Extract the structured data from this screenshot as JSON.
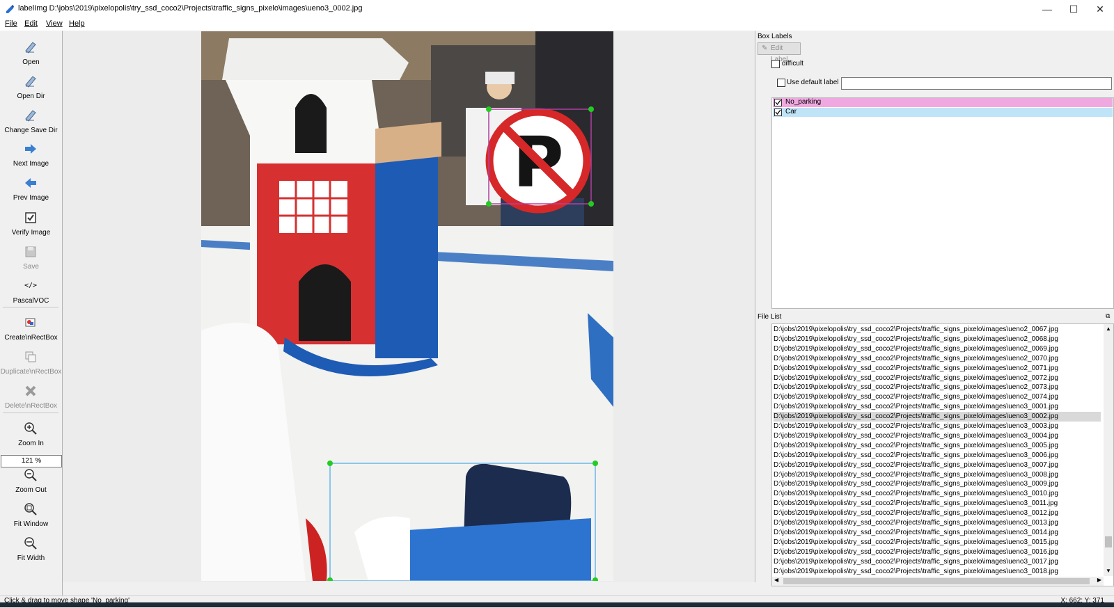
{
  "window": {
    "title": "labelImg D:\\jobs\\2019\\pixelopolis\\try_ssd_coco2\\Projects\\traffic_signs_pixelo\\images\\ueno3_0002.jpg",
    "minimize": "—",
    "maximize": "☐",
    "close": "✕"
  },
  "menu": [
    "File",
    "Edit",
    "View",
    "Help"
  ],
  "toolbar": {
    "open": "Open",
    "open_dir": "Open Dir",
    "change_save_dir": "Change Save Dir",
    "next_image": "Next Image",
    "prev_image": "Prev Image",
    "verify_image": "Verify Image",
    "save": "Save",
    "format_icon_text": "</>",
    "format": "PascalVOC",
    "create_rectbox": "Create\\nRectBox",
    "duplicate_rectbox": "Duplicate\\nRectBox",
    "delete_rectbox": "Delete\\nRectBox",
    "zoom_in": "Zoom In",
    "zoom_value": "121 %",
    "zoom_out": "Zoom Out",
    "fit_window": "Fit Window",
    "fit_width": "Fit Width"
  },
  "box_labels": {
    "title": "Box Labels",
    "edit_label": "Edit Label",
    "difficult": "difficult",
    "use_default_label": "Use default label",
    "default_label_value": "",
    "labels": [
      {
        "name": "No_parking",
        "checked": true,
        "color": "#f0a8e0"
      },
      {
        "name": "Car",
        "checked": true,
        "color": "#bfe3f7"
      }
    ]
  },
  "file_list": {
    "title": "File List",
    "selected_index": 9,
    "files": [
      "D:\\jobs\\2019\\pixelopolis\\try_ssd_coco2\\Projects\\traffic_signs_pixelo\\images\\ueno2_0067.jpg",
      "D:\\jobs\\2019\\pixelopolis\\try_ssd_coco2\\Projects\\traffic_signs_pixelo\\images\\ueno2_0068.jpg",
      "D:\\jobs\\2019\\pixelopolis\\try_ssd_coco2\\Projects\\traffic_signs_pixelo\\images\\ueno2_0069.jpg",
      "D:\\jobs\\2019\\pixelopolis\\try_ssd_coco2\\Projects\\traffic_signs_pixelo\\images\\ueno2_0070.jpg",
      "D:\\jobs\\2019\\pixelopolis\\try_ssd_coco2\\Projects\\traffic_signs_pixelo\\images\\ueno2_0071.jpg",
      "D:\\jobs\\2019\\pixelopolis\\try_ssd_coco2\\Projects\\traffic_signs_pixelo\\images\\ueno2_0072.jpg",
      "D:\\jobs\\2019\\pixelopolis\\try_ssd_coco2\\Projects\\traffic_signs_pixelo\\images\\ueno2_0073.jpg",
      "D:\\jobs\\2019\\pixelopolis\\try_ssd_coco2\\Projects\\traffic_signs_pixelo\\images\\ueno2_0074.jpg",
      "D:\\jobs\\2019\\pixelopolis\\try_ssd_coco2\\Projects\\traffic_signs_pixelo\\images\\ueno3_0001.jpg",
      "D:\\jobs\\2019\\pixelopolis\\try_ssd_coco2\\Projects\\traffic_signs_pixelo\\images\\ueno3_0002.jpg",
      "D:\\jobs\\2019\\pixelopolis\\try_ssd_coco2\\Projects\\traffic_signs_pixelo\\images\\ueno3_0003.jpg",
      "D:\\jobs\\2019\\pixelopolis\\try_ssd_coco2\\Projects\\traffic_signs_pixelo\\images\\ueno3_0004.jpg",
      "D:\\jobs\\2019\\pixelopolis\\try_ssd_coco2\\Projects\\traffic_signs_pixelo\\images\\ueno3_0005.jpg",
      "D:\\jobs\\2019\\pixelopolis\\try_ssd_coco2\\Projects\\traffic_signs_pixelo\\images\\ueno3_0006.jpg",
      "D:\\jobs\\2019\\pixelopolis\\try_ssd_coco2\\Projects\\traffic_signs_pixelo\\images\\ueno3_0007.jpg",
      "D:\\jobs\\2019\\pixelopolis\\try_ssd_coco2\\Projects\\traffic_signs_pixelo\\images\\ueno3_0008.jpg",
      "D:\\jobs\\2019\\pixelopolis\\try_ssd_coco2\\Projects\\traffic_signs_pixelo\\images\\ueno3_0009.jpg",
      "D:\\jobs\\2019\\pixelopolis\\try_ssd_coco2\\Projects\\traffic_signs_pixelo\\images\\ueno3_0010.jpg",
      "D:\\jobs\\2019\\pixelopolis\\try_ssd_coco2\\Projects\\traffic_signs_pixelo\\images\\ueno3_0011.jpg",
      "D:\\jobs\\2019\\pixelopolis\\try_ssd_coco2\\Projects\\traffic_signs_pixelo\\images\\ueno3_0012.jpg",
      "D:\\jobs\\2019\\pixelopolis\\try_ssd_coco2\\Projects\\traffic_signs_pixelo\\images\\ueno3_0013.jpg",
      "D:\\jobs\\2019\\pixelopolis\\try_ssd_coco2\\Projects\\traffic_signs_pixelo\\images\\ueno3_0014.jpg",
      "D:\\jobs\\2019\\pixelopolis\\try_ssd_coco2\\Projects\\traffic_signs_pixelo\\images\\ueno3_0015.jpg",
      "D:\\jobs\\2019\\pixelopolis\\try_ssd_coco2\\Projects\\traffic_signs_pixelo\\images\\ueno3_0016.jpg",
      "D:\\jobs\\2019\\pixelopolis\\try_ssd_coco2\\Projects\\traffic_signs_pixelo\\images\\ueno3_0017.jpg",
      "D:\\jobs\\2019\\pixelopolis\\try_ssd_coco2\\Projects\\traffic_signs_pixelo\\images\\ueno3_0018.jpg"
    ]
  },
  "status": {
    "message": "Click & drag to move shape 'No_parking'",
    "coords": "X: 662; Y: 371"
  },
  "canvas": {
    "no_parking_box_color": "#b040a0",
    "car_box_color": "#6ab8e8",
    "handle_color": "#22cc22"
  },
  "colors": {
    "selected_file": "#d9d9d9",
    "no_parking_row": "#f0a8e0",
    "car_row": "#bfe3f7"
  }
}
